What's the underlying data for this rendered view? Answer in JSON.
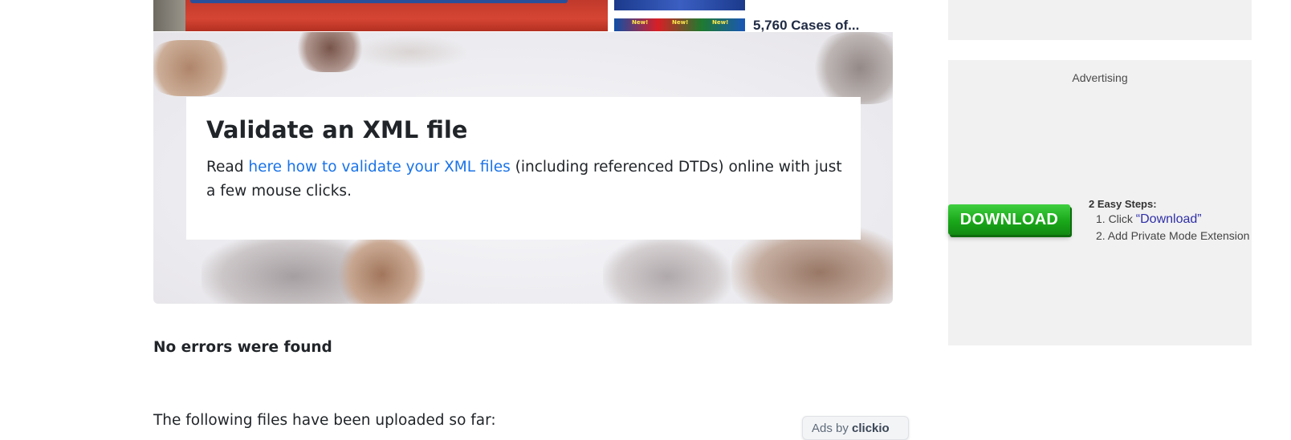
{
  "promo": {
    "headline": "5,760 Cases of...",
    "thumb_badges": [
      "New!",
      "New!",
      "New!"
    ]
  },
  "hero": {
    "title": "Validate an XML file",
    "text_before": "Read ",
    "link_text": "here how to validate your XML files",
    "text_after": " (including referenced DTDs) online with just a few mouse clicks."
  },
  "result": {
    "status": "No errors were found",
    "uploaded_heading": "The following files have been uploaded so far:"
  },
  "ads_badge": {
    "prefix": "Ads by ",
    "brand": "clickio"
  },
  "sidebar": {
    "ad": {
      "label": "Advertising",
      "download_button": "DOWNLOAD",
      "steps_title": "2 Easy Steps:",
      "step1_prefix": "1. Click ",
      "step1_link": "“Download”",
      "step2": "2. Add Private Mode Extension"
    }
  },
  "colors": {
    "link": "#1a73e8",
    "download_green": "#1aa81a",
    "sidebar_bg": "#f1f1f1"
  }
}
